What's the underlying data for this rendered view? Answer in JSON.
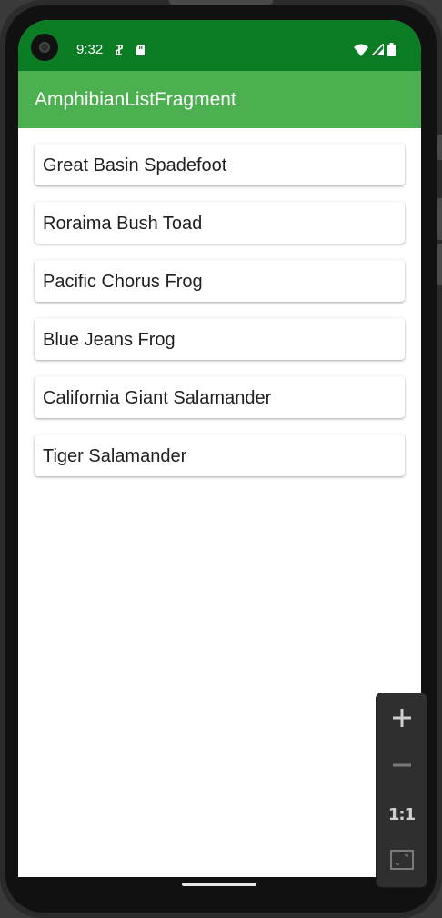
{
  "status_bar": {
    "time": "9:32",
    "background_color": "#0a7d24",
    "left_icons": [
      "usb-debug-icon",
      "sd-card-icon"
    ],
    "right_icons": [
      "wifi-icon",
      "cell-signal-icon",
      "battery-icon"
    ]
  },
  "app_bar": {
    "title": "AmphibianListFragment",
    "background_color": "#4caf50"
  },
  "amphibians": [
    {
      "name": "Great Basin Spadefoot"
    },
    {
      "name": "Roraima Bush Toad"
    },
    {
      "name": "Pacific Chorus Frog"
    },
    {
      "name": "Blue Jeans Frog"
    },
    {
      "name": "California Giant Salamander"
    },
    {
      "name": "Tiger Salamander"
    }
  ],
  "emulator_zoom_controls": {
    "zoom_in": "+",
    "zoom_out": "−",
    "actual_size": "1:1",
    "fit_icon": "fit-screen-icon"
  }
}
